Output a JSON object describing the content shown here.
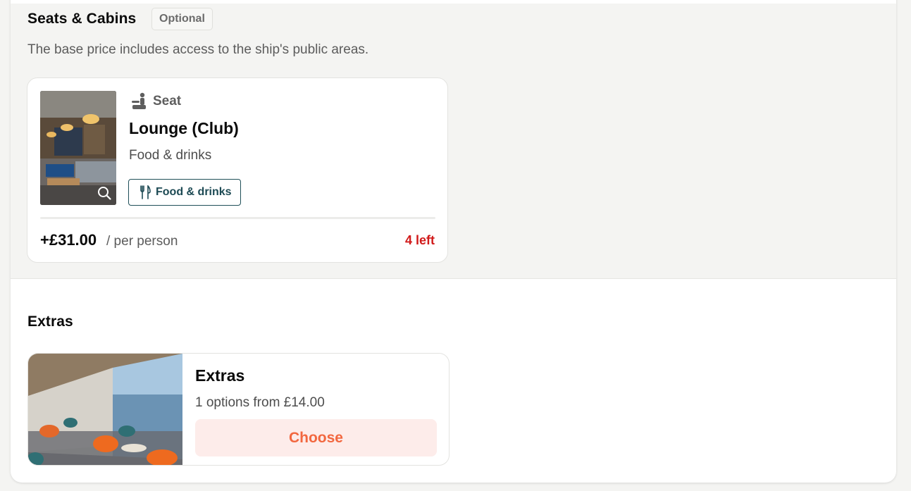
{
  "seats_section": {
    "title": "Seats & Cabins",
    "badge": "Optional",
    "description": "The base price includes access to the ship's public areas."
  },
  "seat_card": {
    "type_label": "Seat",
    "type_icon": "seat-icon",
    "name": "Lounge (Club)",
    "subtitle": "Food & drinks",
    "tag_label": "Food & drinks",
    "tag_icon": "fork-knife-icon",
    "price": "+£31.00",
    "per_label": "/ per person",
    "availability": "4 left",
    "image_action_icon": "zoom-icon"
  },
  "extras_section": {
    "title": "Extras"
  },
  "extras_card": {
    "name": "Extras",
    "options_text": "1 options from £14.00",
    "button_label": "Choose"
  },
  "colors": {
    "accent": "#f2673f",
    "accent_bg": "#fdecea",
    "availability_red": "#d11a1a",
    "tag_teal": "#1d4a54",
    "section_bg": "#f4f4f2"
  }
}
